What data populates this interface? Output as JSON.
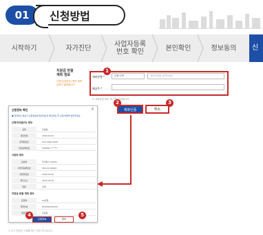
{
  "header": {
    "step_number": "01",
    "title": "신청방법"
  },
  "steps": [
    {
      "label": "시작하기"
    },
    {
      "label": "자가진단"
    },
    {
      "label": "사업자등록\n번호 확인"
    },
    {
      "label": "본인확인"
    },
    {
      "label": "정보동의"
    },
    {
      "label": "신"
    }
  ],
  "form": {
    "card_label": "지원금 받을\n계좌 정보",
    "card_sub": "신청인(대표자) 명의 계좌\n입력이 필요합니다",
    "bank_label": "계좌은행 *",
    "account_label": "예금주 *",
    "bank_select": "은행 선택",
    "account_placeholder": "계좌번호를 입력하세요",
    "note": "※ 계좌번호 확인 후 신청 가능합니다."
  },
  "buttons": {
    "auth": "계좌인증",
    "cancel": "취소"
  },
  "badges": [
    "1",
    "2",
    "3",
    "4",
    "5"
  ],
  "popup": {
    "title": "신청정보 확인",
    "close": "×",
    "desc": "● 입력하신 정보가 신청정보와 일치하는지 확인하신 후 신청 버튼을 눌러주세요.",
    "sections": [
      {
        "title": "신청자(대표자) 정보",
        "rows": [
          {
            "k": "성명",
            "v": "홍길동"
          },
          {
            "k": "생년월일",
            "v": "1990.00.00"
          },
          {
            "k": "휴대폰번호",
            "v": "010-0000-0000"
          },
          {
            "k": "주민등록번호",
            "v": "900000-*******"
          }
        ]
      },
      {
        "title": "사업장 정보",
        "rows": [
          {
            "k": "상호명",
            "v": "주식회사 00000"
          },
          {
            "k": "사업자등록번호",
            "v": "000-00-00000"
          },
          {
            "k": "개업연월일",
            "v": "0000.00.00"
          },
          {
            "k": "매출감소",
            "v": "2020.00.00"
          },
          {
            "k": "업종",
            "v": "소매"
          }
        ]
      },
      {
        "title": "지원금 받을 계좌 정보",
        "rows": [
          {
            "k": "은행명",
            "v": "00은행"
          },
          {
            "k": "계좌번호",
            "v": "000000000000"
          },
          {
            "k": "예금주",
            "v": "홍길동"
          }
        ]
      }
    ],
    "apply": "신청완료",
    "cancel": "취소"
  },
  "footer": "※ 상기 화면은 이해를 돕기 위한 예시입니다.",
  "colors": {
    "primary": "#1d4fa6",
    "highlight": "#c62828",
    "stepbar": "#ededed"
  }
}
